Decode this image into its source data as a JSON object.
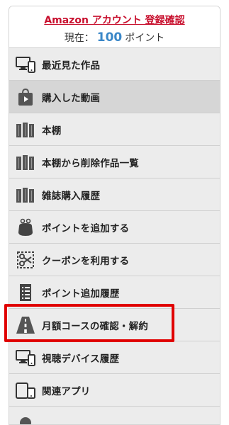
{
  "header": {
    "account_link": "Amazon アカウント 登録確認",
    "points_prefix": "現在：",
    "points_value": "100",
    "points_suffix": "ポイント"
  },
  "menu": {
    "items": [
      {
        "label": "最近見た作品",
        "icon": "devices-icon"
      },
      {
        "label": "購入した動画",
        "icon": "shopping-bag-play-icon"
      },
      {
        "label": "本棚",
        "icon": "bookshelf-icon"
      },
      {
        "label": "本棚から削除作品一覧",
        "icon": "bookshelf-icon"
      },
      {
        "label": "雑誌購入履歴",
        "icon": "bookshelf-icon"
      },
      {
        "label": "ポイントを追加する",
        "icon": "coin-purse-icon"
      },
      {
        "label": "クーポンを利用する",
        "icon": "scissors-coupon-icon"
      },
      {
        "label": "ポイント追加履歴",
        "icon": "receipt-list-icon"
      },
      {
        "label": "月額コースの確認・解約",
        "icon": "road-icon"
      },
      {
        "label": "視聴デバイス履歴",
        "icon": "devices-icon"
      },
      {
        "label": "関連アプリ",
        "icon": "devices-icon"
      }
    ]
  },
  "colors": {
    "accent_red": "#c8102e",
    "points_blue": "#3a87c8",
    "highlight_border": "#e00000",
    "menu_bg": "#ececec",
    "menu_active_bg": "#d6d6d6"
  }
}
